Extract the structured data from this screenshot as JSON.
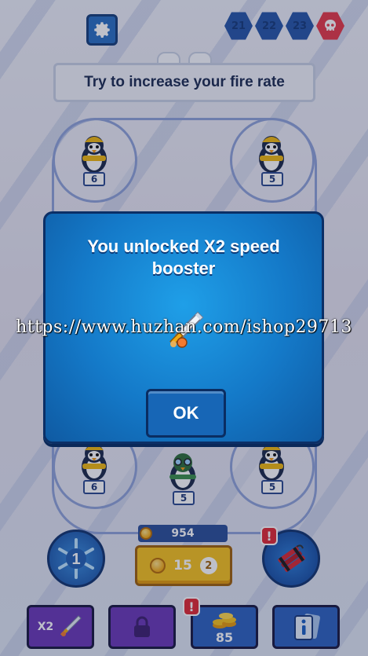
{
  "header": {
    "settings_icon": "gear-icon",
    "levels": [
      "21",
      "22",
      "23"
    ],
    "boss_icon": "skull-icon",
    "hint": "Try to increase your fire rate"
  },
  "towers": {
    "top_left_level": "6",
    "top_right_level": "5",
    "bottom_left_level": "6",
    "bottom_center_level": "5",
    "bottom_right_level": "5"
  },
  "modal": {
    "title": "You unlocked X2 speed booster",
    "reward_icon": "sword-icon",
    "ok_label": "OK"
  },
  "watermark": "https://www.huzhan.com/ishop29713",
  "hud": {
    "freeze_count": "1",
    "coins": "954",
    "buy_price": "15",
    "buy_cost_badge": "2",
    "x2_label": "X2",
    "coins_pack_amount": "85"
  },
  "colors": {
    "modal_blue": "#1479c8",
    "button_yellow": "#f7c21e",
    "alert_red": "#e22a34",
    "boss_red": "#e63a48"
  }
}
